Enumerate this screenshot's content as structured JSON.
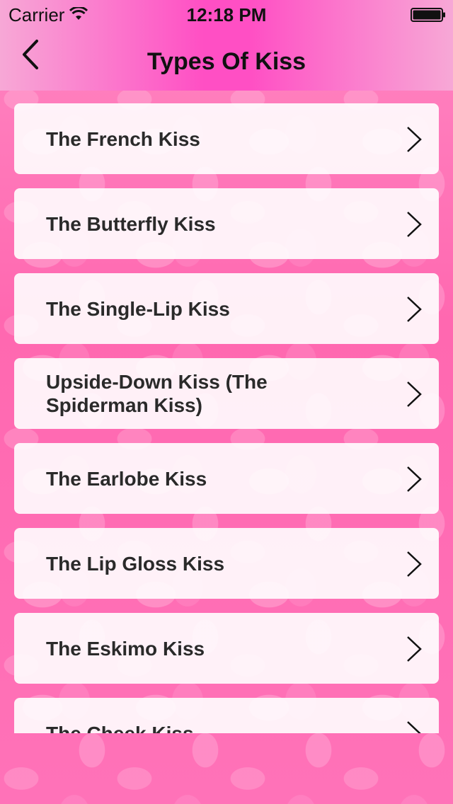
{
  "status_bar": {
    "carrier": "Carrier",
    "time": "12:18 PM",
    "wifi_icon": "wifi-icon",
    "battery_icon": "battery-icon"
  },
  "nav": {
    "title": "Types Of Kiss",
    "back_icon": "chevron-left-icon",
    "background_colors": [
      "#f7a8d6",
      "#ff4fc4"
    ]
  },
  "list": {
    "items": [
      {
        "label": "The French Kiss"
      },
      {
        "label": "The Butterfly Kiss"
      },
      {
        "label": "The Single-Lip Kiss"
      },
      {
        "label": "Upside-Down Kiss (The Spiderman Kiss)"
      },
      {
        "label": "The Earlobe Kiss"
      },
      {
        "label": "The Lip Gloss Kiss"
      },
      {
        "label": "The Eskimo Kiss"
      },
      {
        "label": "The Cheek Kiss"
      }
    ],
    "item_icon": "chevron-right-icon"
  },
  "theme": {
    "background": "#ff72b6",
    "card": "#ffffff",
    "text": "#2a2a2a"
  }
}
